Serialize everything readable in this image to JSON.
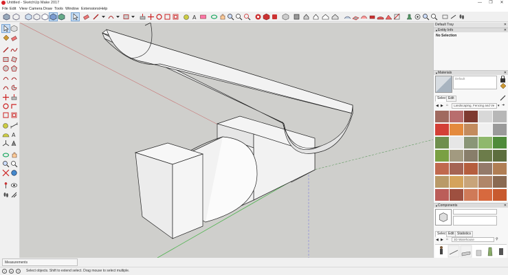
{
  "window": {
    "title": "Untitled - SketchUp Make 2017",
    "controls": [
      "—",
      "❐",
      "✕"
    ]
  },
  "menu": [
    "File",
    "Edit",
    "View",
    "Camera",
    "Draw",
    "Tools",
    "Window",
    "Extensions",
    "Help"
  ],
  "toolbar_icons": [
    "iso-view-icon",
    "wireframe-view-icon",
    "xray-icon",
    "back-edges-icon",
    "wire-icon",
    "hidden-line-icon",
    "shaded-icon",
    "shaded-texture-icon",
    "monochrome-icon",
    "select-icon",
    "eraser-icon",
    "paint-bucket-icon",
    "pencil-line-icon",
    "dropdown-icon",
    "arc-icon",
    "dropdown-icon",
    "shape-icon",
    "dropdown-icon",
    "push-pull-icon",
    "move-icon",
    "rotate-icon",
    "scale-icon",
    "offset-icon",
    "tape-measure-icon",
    "protractor-icon",
    "text-icon",
    "section-plane-icon",
    "orbit-icon",
    "pan-icon",
    "zoom-icon",
    "zoom-window-icon",
    "zoom-extents-icon",
    "warehouse-icon",
    "share-model-icon",
    "extension-warehouse-icon",
    "iso-icon",
    "top-view-icon",
    "front-view-icon",
    "right-view-icon",
    "back-view-icon",
    "left-view-icon",
    "sandbox-from-contours-icon",
    "sandbox-from-scratch-icon",
    "smoove-icon",
    "stamp-icon",
    "drape-icon",
    "add-detail-icon",
    "flip-edge-icon",
    "position-camera-icon",
    "look-around-icon",
    "walk-icon",
    "section-plane-icon",
    "display-section-icon",
    "display-cuts-icon",
    "footprint-icon"
  ],
  "left_tools": [
    "select-icon",
    "make-component-icon",
    "paint-bucket-icon",
    "eraser-icon",
    "line-icon",
    "freehand-icon",
    "rectangle-icon",
    "rotated-rectangle-icon",
    "circle-icon",
    "polygon-icon",
    "arc-icon",
    "two-point-arc-icon",
    "three-point-arc-icon",
    "pie-icon",
    "move-icon",
    "push-pull-icon",
    "rotate-icon",
    "follow-me-icon",
    "scale-icon",
    "offset-icon",
    "tape-measure-icon",
    "dimension-icon",
    "protractor-icon",
    "text-icon",
    "axes-icon",
    "3d-text-icon",
    "orbit-icon",
    "pan-icon",
    "zoom-icon",
    "zoom-window-icon",
    "zoom-extents-icon",
    "previous-view-icon",
    "position-camera-icon",
    "look-around-icon",
    "walk-icon",
    "section-plane-icon"
  ],
  "tray": {
    "title": "Default Tray",
    "entity_info": {
      "header": "Entity Info",
      "selection": "No Selection"
    },
    "materials": {
      "header": "Materials",
      "name": "Default",
      "tabs": [
        "Select",
        "Edit"
      ],
      "collection": "Landscaping, Fencing and Ve",
      "swatch_colors": [
        "#a06a5f",
        "#b86d6d",
        "#7e3a30",
        "#d8d8d8",
        "#b7b7b7",
        "#d33f36",
        "#e48a3e",
        "#c38b5e",
        "#f0f0f0",
        "#9a9a9a",
        "#6f8f4e",
        "#e6e6e6",
        "#8a9677",
        "#8fb86c",
        "#4f8b3a",
        "#7aa043",
        "#a29a80",
        "#887e6a",
        "#6c7c4a",
        "#5d6e3e",
        "#c0694e",
        "#a56454",
        "#b55e3e",
        "#947a6a",
        "#b07e54",
        "#b99a68",
        "#d4a35c",
        "#c8a47a",
        "#b0866a",
        "#8a6a52",
        "#bb5d59",
        "#9e5040",
        "#cf7a58",
        "#d7693e",
        "#c85a2e"
      ]
    },
    "components": {
      "header": "Components",
      "tabs": [
        "Select",
        "Edit",
        "Statistics"
      ],
      "search_placeholder": "3D Warehouse"
    }
  },
  "measurements": {
    "label": "Measurements"
  },
  "status": {
    "text": "Select objects. Shift to extend select. Drag mouse to select multiple."
  }
}
